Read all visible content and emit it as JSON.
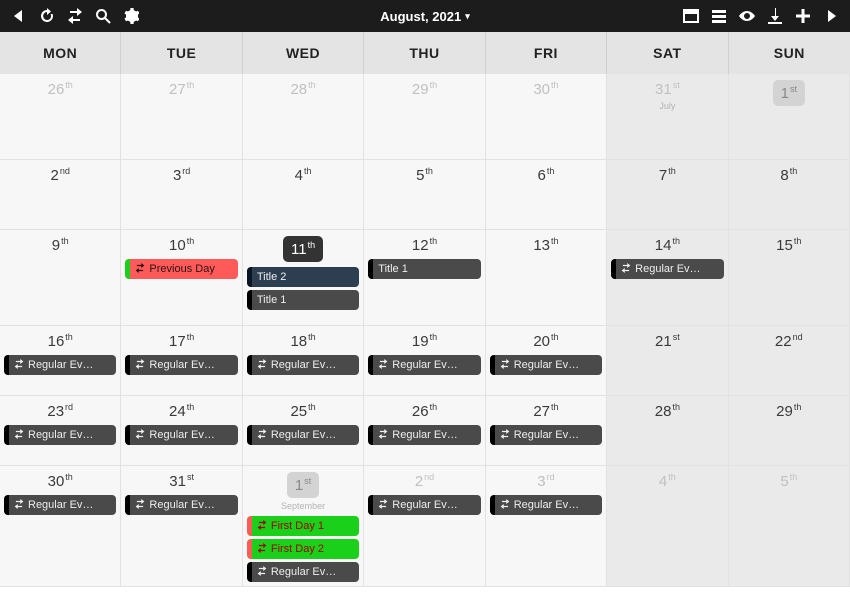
{
  "toolbar": {
    "title": "August, 2021",
    "dropdown_glyph": "▾",
    "icons": {
      "prev": "triangle-left",
      "refresh": "refresh",
      "exchange": "exchange",
      "search": "search",
      "settings": "gear",
      "window": "window",
      "rows": "rows",
      "visibility": "visibility",
      "download": "download",
      "add": "plus",
      "next": "triangle-right"
    }
  },
  "dow": [
    "MON",
    "TUE",
    "WED",
    "THU",
    "FRI",
    "SAT",
    "SUN"
  ],
  "event_labels": {
    "previous_day": "Previous Day",
    "title1": "Title 1",
    "title2": "Title 2",
    "regular_ev": "Regular Ev…",
    "first_day_1": "First Day 1",
    "first_day_2": "First Day 2"
  },
  "month_sub": {
    "july": "July",
    "september": "September"
  },
  "cells": [
    {
      "d": "26",
      "ord": "th",
      "out": true,
      "weekend": false
    },
    {
      "d": "27",
      "ord": "th",
      "out": true,
      "weekend": false
    },
    {
      "d": "28",
      "ord": "th",
      "out": true,
      "weekend": false
    },
    {
      "d": "29",
      "ord": "th",
      "out": true,
      "weekend": false
    },
    {
      "d": "30",
      "ord": "th",
      "out": true,
      "weekend": false
    },
    {
      "d": "31",
      "ord": "st",
      "out": true,
      "weekend": true,
      "sub": "july"
    },
    {
      "d": "1",
      "ord": "st",
      "out": true,
      "weekend": true,
      "pill": "grey"
    },
    {
      "d": "2",
      "ord": "nd"
    },
    {
      "d": "3",
      "ord": "rd"
    },
    {
      "d": "4",
      "ord": "th"
    },
    {
      "d": "5",
      "ord": "th"
    },
    {
      "d": "6",
      "ord": "th"
    },
    {
      "d": "7",
      "ord": "th",
      "weekend": true
    },
    {
      "d": "8",
      "ord": "th",
      "weekend": true
    },
    {
      "d": "9",
      "ord": "th"
    },
    {
      "d": "10",
      "ord": "th",
      "events": [
        {
          "t": "previous_day",
          "cls": "ev-red",
          "icon": true,
          "accent": true
        }
      ]
    },
    {
      "d": "11",
      "ord": "th",
      "pill": "dark",
      "events": [
        {
          "t": "title2",
          "cls": "ev-navy",
          "accent": true
        },
        {
          "t": "title1",
          "cls": "ev-darkgrey",
          "accent": true
        }
      ]
    },
    {
      "d": "12",
      "ord": "th",
      "events": [
        {
          "t": "title1",
          "cls": "ev-darkgrey",
          "accent": true
        }
      ]
    },
    {
      "d": "13",
      "ord": "th"
    },
    {
      "d": "14",
      "ord": "th",
      "weekend": true,
      "events": [
        {
          "t": "regular_ev",
          "cls": "ev-darkgrey",
          "icon": true,
          "accent": true
        }
      ]
    },
    {
      "d": "15",
      "ord": "th",
      "weekend": true
    },
    {
      "d": "16",
      "ord": "th",
      "events": [
        {
          "t": "regular_ev",
          "cls": "ev-darkgrey",
          "icon": true,
          "accent": true
        }
      ]
    },
    {
      "d": "17",
      "ord": "th",
      "events": [
        {
          "t": "regular_ev",
          "cls": "ev-darkgrey",
          "icon": true,
          "accent": true
        }
      ]
    },
    {
      "d": "18",
      "ord": "th",
      "events": [
        {
          "t": "regular_ev",
          "cls": "ev-darkgrey",
          "icon": true,
          "accent": true
        }
      ]
    },
    {
      "d": "19",
      "ord": "th",
      "events": [
        {
          "t": "regular_ev",
          "cls": "ev-darkgrey",
          "icon": true,
          "accent": true
        }
      ]
    },
    {
      "d": "20",
      "ord": "th",
      "events": [
        {
          "t": "regular_ev",
          "cls": "ev-darkgrey",
          "icon": true,
          "accent": true
        }
      ]
    },
    {
      "d": "21",
      "ord": "st",
      "weekend": true
    },
    {
      "d": "22",
      "ord": "nd",
      "weekend": true
    },
    {
      "d": "23",
      "ord": "rd",
      "events": [
        {
          "t": "regular_ev",
          "cls": "ev-darkgrey",
          "icon": true,
          "accent": true
        }
      ]
    },
    {
      "d": "24",
      "ord": "th",
      "events": [
        {
          "t": "regular_ev",
          "cls": "ev-darkgrey",
          "icon": true,
          "accent": true
        }
      ]
    },
    {
      "d": "25",
      "ord": "th",
      "events": [
        {
          "t": "regular_ev",
          "cls": "ev-darkgrey",
          "icon": true,
          "accent": true
        }
      ]
    },
    {
      "d": "26",
      "ord": "th",
      "events": [
        {
          "t": "regular_ev",
          "cls": "ev-darkgrey",
          "icon": true,
          "accent": true
        }
      ]
    },
    {
      "d": "27",
      "ord": "th",
      "events": [
        {
          "t": "regular_ev",
          "cls": "ev-darkgrey",
          "icon": true,
          "accent": true
        }
      ]
    },
    {
      "d": "28",
      "ord": "th",
      "weekend": true
    },
    {
      "d": "29",
      "ord": "th",
      "weekend": true
    },
    {
      "d": "30",
      "ord": "th",
      "events": [
        {
          "t": "regular_ev",
          "cls": "ev-darkgrey",
          "icon": true,
          "accent": true
        }
      ]
    },
    {
      "d": "31",
      "ord": "st",
      "events": [
        {
          "t": "regular_ev",
          "cls": "ev-darkgrey",
          "icon": true,
          "accent": true
        }
      ]
    },
    {
      "d": "1",
      "ord": "st",
      "out": true,
      "pill": "grey",
      "sub": "september",
      "events": [
        {
          "t": "first_day_1",
          "cls": "ev-green",
          "icon": true,
          "accent": true
        },
        {
          "t": "first_day_2",
          "cls": "ev-green",
          "icon": true,
          "accent": true
        },
        {
          "t": "regular_ev",
          "cls": "ev-darkgrey",
          "icon": true,
          "accent": true
        }
      ]
    },
    {
      "d": "2",
      "ord": "nd",
      "out": true,
      "events": [
        {
          "t": "regular_ev",
          "cls": "ev-darkgrey",
          "icon": true,
          "accent": true
        }
      ]
    },
    {
      "d": "3",
      "ord": "rd",
      "out": true,
      "events": [
        {
          "t": "regular_ev",
          "cls": "ev-darkgrey",
          "icon": true,
          "accent": true
        }
      ]
    },
    {
      "d": "4",
      "ord": "th",
      "out": true,
      "weekend": true
    },
    {
      "d": "5",
      "ord": "th",
      "out": true,
      "weekend": true
    }
  ]
}
